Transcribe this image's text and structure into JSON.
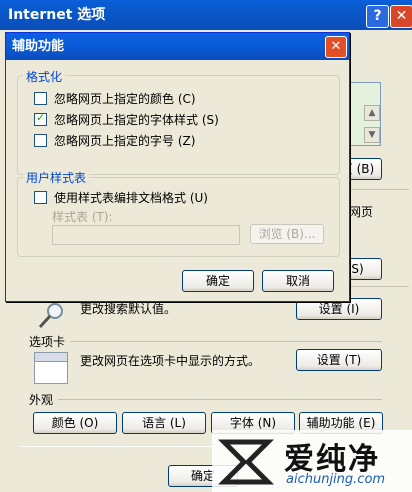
{
  "outer": {
    "title": "Internet 选项",
    "help_btn": "?",
    "close_btn": "✕",
    "right_label_partial": "页 (B)",
    "right_text_partial": "网页",
    "right_btn_partial": "S)",
    "search_text": "更改搜索默认值。",
    "search_btn": "设置 (I)",
    "tabs_section": "选项卡",
    "tabs_text": "更改网页在选项卡中显示的方式。",
    "tabs_btn": "设置 (T)",
    "appearance_section": "外观",
    "btn_colors": "颜色 (O)",
    "btn_lang": "语言 (L)",
    "btn_fonts": "字体 (N)",
    "btn_access": "辅助功能 (E)",
    "ok_partial": "确定"
  },
  "dialog": {
    "title": "辅助功能",
    "close": "✕",
    "format_group": "格式化",
    "opt1": "忽略网页上指定的颜色 (C)",
    "opt2": "忽略网页上指定的字体样式 (S)",
    "opt3": "忽略网页上指定的字号 (Z)",
    "style_group": "用户样式表",
    "opt4": "使用样式表编排文档格式 (U)",
    "stylesheet_label": "样式表 (T):",
    "stylesheet_value": "",
    "browse": "浏览 (B)...",
    "ok": "确定",
    "cancel": "取消",
    "checked": [
      false,
      true,
      false,
      false
    ]
  },
  "watermark": {
    "brand": "爱纯净",
    "url": "aichunjing.com"
  }
}
